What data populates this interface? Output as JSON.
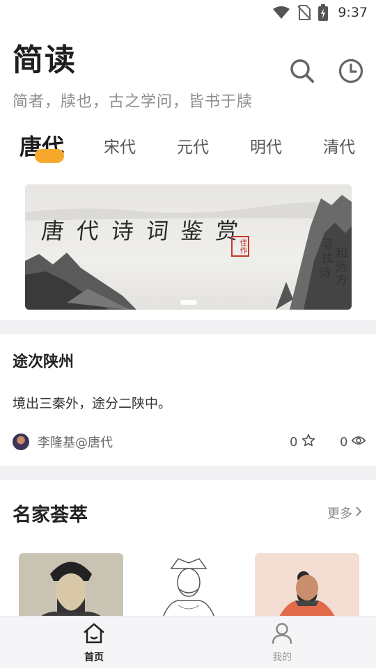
{
  "status_bar": {
    "time": "9:37",
    "icons": [
      "wifi-icon",
      "no-sim-icon",
      "battery-charging-icon"
    ]
  },
  "header": {
    "title": "简读",
    "subtitle": "简者，牍也，古之学问，皆书于牍",
    "icons": [
      "search-icon",
      "history-icon"
    ]
  },
  "tabs": [
    {
      "label": "唐代",
      "active": true
    },
    {
      "label": "宋代",
      "active": false
    },
    {
      "label": "元代",
      "active": false
    },
    {
      "label": "明代",
      "active": false
    },
    {
      "label": "清代",
      "active": false
    }
  ],
  "banner": {
    "title": "唐代诗词鉴赏",
    "seal": "佳作",
    "vertical_text_1": "寻找",
    "vertical_text_2": "和远方",
    "vertical_text_3": "诗"
  },
  "poem": {
    "title": "途次陕州",
    "line": "境出三秦外，途分二陕中。",
    "author": "李隆基@唐代",
    "likes": "0",
    "views": "0"
  },
  "featured": {
    "title": "名家荟萃",
    "more_label": "更多"
  },
  "bottom_nav": {
    "home_label": "首页",
    "me_label": "我的"
  },
  "colors": {
    "accent": "#f6a82c",
    "divider": "#f1f1f3",
    "nav_bg": "#f5f5f7"
  }
}
